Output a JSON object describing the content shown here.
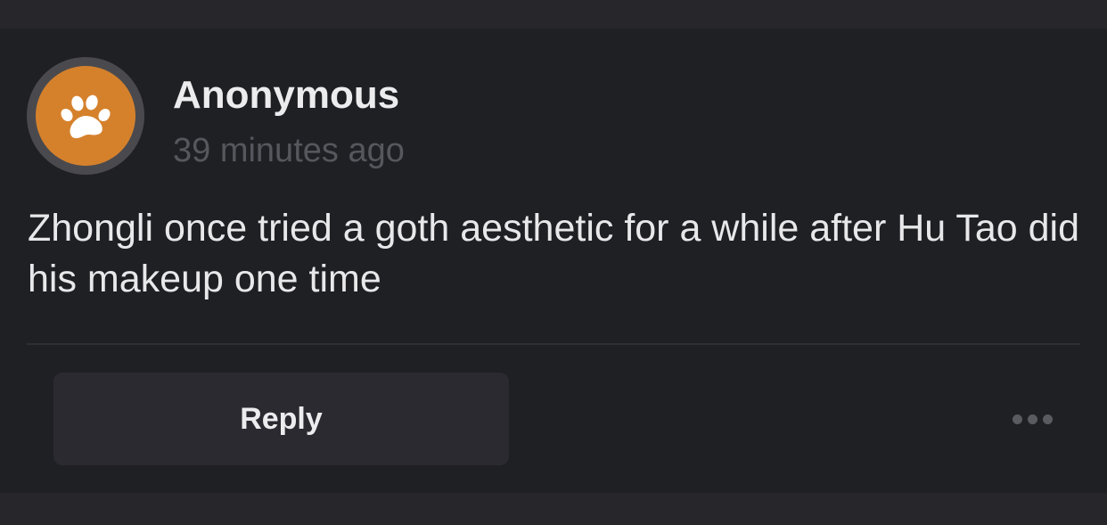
{
  "post": {
    "author": "Anonymous",
    "timestamp": "39 minutes ago",
    "text": "Zhongli once tried a goth aesthetic for a while after Hu Tao did his makeup one time",
    "avatar_icon": "paw-icon",
    "avatar_color": "#d5812c"
  },
  "actions": {
    "reply_label": "Reply",
    "more_icon": "more-dots-icon"
  },
  "colors": {
    "background": "#26262b",
    "card": "#1f2024",
    "text": "#e8e8ea",
    "muted": "#56575c"
  }
}
